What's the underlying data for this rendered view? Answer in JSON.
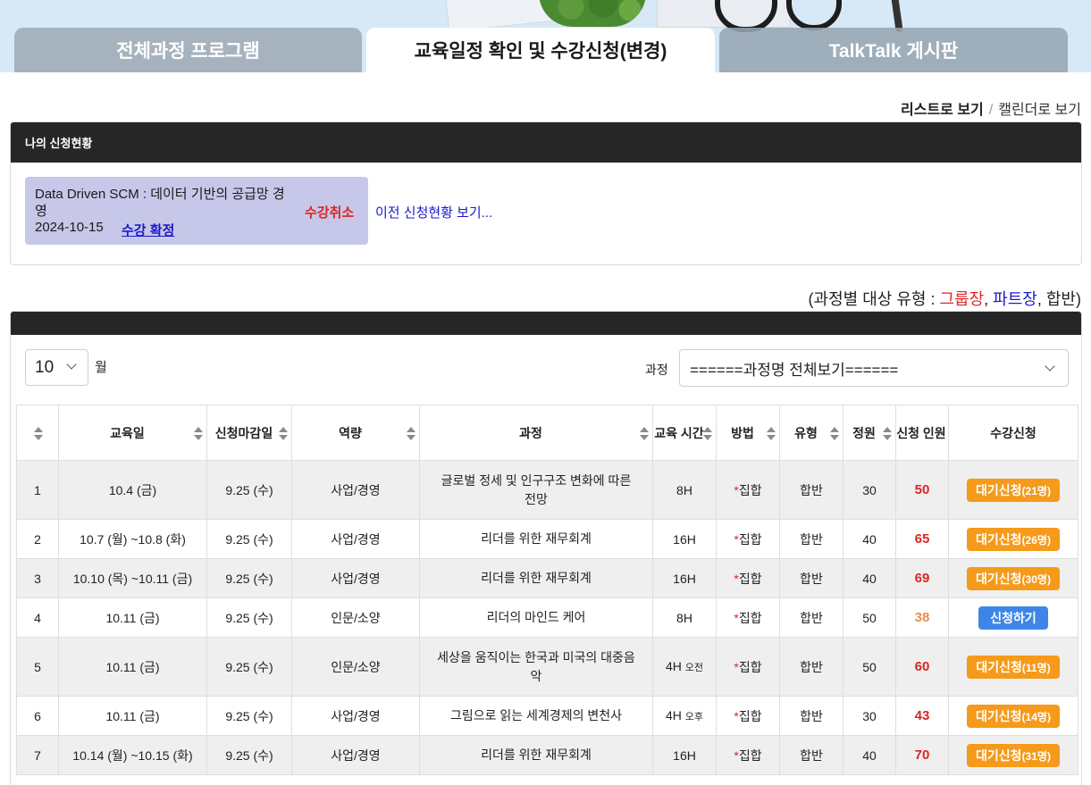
{
  "tabs": [
    {
      "label": "전체과정 프로그램"
    },
    {
      "label": "교육일정 확인 및 수강신청(변경)"
    },
    {
      "label": "TalkTalk 게시판"
    }
  ],
  "view": {
    "list_label": "리스트로 보기",
    "separator": "/",
    "calendar_label": "캘린더로 보기"
  },
  "my_status": {
    "header": "나의 신청현황",
    "card": {
      "course_title": "Data Driven SCM : 데이터 기반의 공급망 경영",
      "date": "2024-10-15",
      "confirm_label": "수강 확정",
      "cancel_label": "수강취소"
    },
    "prev_link": "이전 신청현황 보기..."
  },
  "legend": {
    "prefix": "(과정별 대상 유형 : ",
    "group": "그룹장",
    "comma1": ", ",
    "part": "파트장",
    "comma2": ", ",
    "mixed": "합반",
    "suffix": ")"
  },
  "filters": {
    "month_value": "10",
    "month_unit": "월",
    "course_label": "과정",
    "course_value": "======과정명 전체보기======"
  },
  "table": {
    "headers": [
      "",
      "교육일",
      "신청마감일",
      "역량",
      "과정",
      "교육 시간",
      "방법",
      "유형",
      "정원",
      "신청 인원",
      "수강신청"
    ],
    "rows": [
      {
        "no": "1",
        "date": "10.4 (금)",
        "deadline": "9.25 (수)",
        "competency": "사업/경영",
        "course": "글로벌 정세 및 인구구조 변화에 따른 전망",
        "hours": "8H",
        "hours_note": "",
        "method": "집합",
        "type": "합반",
        "capacity": "30",
        "applicants": "50",
        "applicants_color": "red",
        "action": "대기신청",
        "action_count": "(21명)",
        "action_kind": "wait"
      },
      {
        "no": "2",
        "date": "10.7 (월) ~10.8 (화)",
        "deadline": "9.25 (수)",
        "competency": "사업/경영",
        "course": "리더를 위한 재무회계",
        "hours": "16H",
        "hours_note": "",
        "method": "집합",
        "type": "합반",
        "capacity": "40",
        "applicants": "65",
        "applicants_color": "red",
        "action": "대기신청",
        "action_count": "(26명)",
        "action_kind": "wait"
      },
      {
        "no": "3",
        "date": "10.10 (목) ~10.11 (금)",
        "deadline": "9.25 (수)",
        "competency": "사업/경영",
        "course": "리더를 위한 재무회계",
        "hours": "16H",
        "hours_note": "",
        "method": "집합",
        "type": "합반",
        "capacity": "40",
        "applicants": "69",
        "applicants_color": "red",
        "action": "대기신청",
        "action_count": "(30명)",
        "action_kind": "wait"
      },
      {
        "no": "4",
        "date": "10.11 (금)",
        "deadline": "9.25 (수)",
        "competency": "인문/소양",
        "course": "리더의 마인드 케어",
        "hours": "8H",
        "hours_note": "",
        "method": "집합",
        "type": "합반",
        "capacity": "50",
        "applicants": "38",
        "applicants_color": "orange",
        "action": "신청하기",
        "action_count": "",
        "action_kind": "apply"
      },
      {
        "no": "5",
        "date": "10.11 (금)",
        "deadline": "9.25 (수)",
        "competency": "인문/소양",
        "course": "세상을 움직이는 한국과 미국의 대중음악",
        "hours": "4H",
        "hours_note": "오전",
        "method": "집합",
        "type": "합반",
        "capacity": "50",
        "applicants": "60",
        "applicants_color": "red",
        "action": "대기신청",
        "action_count": "(11명)",
        "action_kind": "wait"
      },
      {
        "no": "6",
        "date": "10.11 (금)",
        "deadline": "9.25 (수)",
        "competency": "사업/경영",
        "course": "그림으로 읽는 세계경제의 변천사",
        "hours": "4H",
        "hours_note": "오후",
        "method": "집합",
        "type": "합반",
        "capacity": "30",
        "applicants": "43",
        "applicants_color": "red",
        "action": "대기신청",
        "action_count": "(14명)",
        "action_kind": "wait"
      },
      {
        "no": "7",
        "date": "10.14 (월) ~10.15 (화)",
        "deadline": "9.25 (수)",
        "competency": "사업/경영",
        "course": "리더를 위한 재무회계",
        "hours": "16H",
        "hours_note": "",
        "method": "집합",
        "type": "합반",
        "capacity": "40",
        "applicants": "70",
        "applicants_color": "red",
        "action": "대기신청",
        "action_count": "(31명)",
        "action_kind": "wait"
      }
    ]
  },
  "colors": {
    "wait_button": "#f59a1a",
    "apply_button": "#3d86e8",
    "red": "#e02424",
    "blue": "#1a1acc",
    "header_dark": "#262626",
    "card_bg": "#c7c7e9"
  }
}
